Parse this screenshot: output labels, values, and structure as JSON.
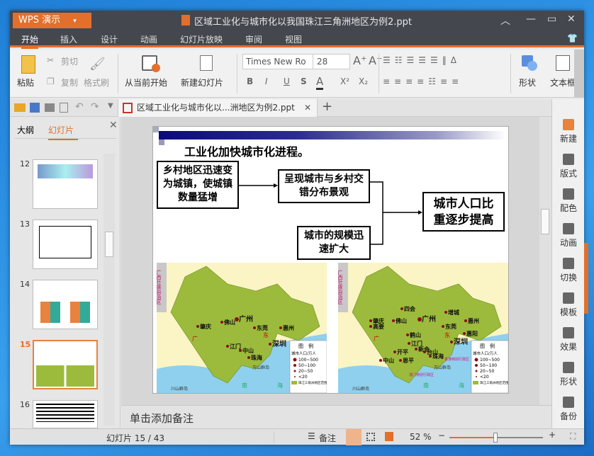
{
  "window": {
    "app_label": "WPS 演示",
    "title": "区域工业化与城市化以我国珠江三角洲地区为例2.ppt"
  },
  "menu": [
    "开始",
    "插入",
    "设计",
    "动画",
    "幻灯片放映",
    "审阅",
    "视图"
  ],
  "ribbon": {
    "paste": "粘贴",
    "cut": "剪切",
    "copy": "复制",
    "format_painter": "格式刷",
    "play_from_current": "从当前开始",
    "new_slide": "新建幻灯片",
    "font_name": "Times New Ro",
    "font_size": "28",
    "bold": "B",
    "italic": "I",
    "underline": "U",
    "shadow": "S",
    "font_color": "A",
    "superscript": "X²",
    "subscript": "X₂",
    "shape": "形状",
    "textbox": "文本框"
  },
  "doc_tab": {
    "label": "区域工业化与城市化以...洲地区为例2.ppt"
  },
  "left_panel": {
    "tabs": [
      "大纲",
      "幻灯片"
    ],
    "active_tab": "幻灯片",
    "slide_numbers": [
      "12",
      "13",
      "14",
      "15",
      "16"
    ],
    "selected": "15"
  },
  "slide": {
    "heading": "工业化加快城市化进程。",
    "boxes": {
      "rural": "乡村地区迅速变为城镇，使城镇数量猛增",
      "mixed": "呈现城市与乡村交错分布景观",
      "expand": "城市的规模迅速扩大",
      "result": "城市人口比重逐步提高"
    },
    "map_left": {
      "province_label": "广西壮族自治区",
      "cities": [
        "广州",
        "佛山",
        "肇庆",
        "东莞",
        "惠州",
        "深圳",
        "江门",
        "中山",
        "珠海"
      ],
      "region": [
        "广",
        "东"
      ],
      "sea": [
        "南",
        "海"
      ],
      "islands": "川山群岛",
      "other_islands": "万山群岛",
      "legend_title": "图　例",
      "legend_unit": "城市人口/万人",
      "legend_items": [
        "100~500",
        "50~100",
        "20~50",
        "<20",
        "珠江三角洲地区范围"
      ]
    },
    "map_right": {
      "province_label": "广西壮族自治区",
      "cities": [
        "四会",
        "增城",
        "肇庆",
        "高要",
        "佛山",
        "广州",
        "东莞",
        "惠州",
        "鹤山",
        "江门",
        "惠阳",
        "深圳",
        "开平",
        "新会",
        "中山",
        "恩平",
        "台山",
        "珠海"
      ],
      "special": [
        "香港特别行政区",
        "澳门特别行政区"
      ],
      "region": [
        "广",
        "东"
      ],
      "sea": [
        "南",
        "海"
      ],
      "islands": "川山群岛",
      "other_islands": "万山群岛",
      "legend_title": "图　例",
      "legend_unit": "城市人口/万人",
      "legend_items": [
        "100~500",
        "50~100",
        "20~50",
        "<20",
        "珠江三角洲地区范围"
      ]
    }
  },
  "notes_placeholder": "单击添加备注",
  "right_sidebar": [
    "新建",
    "版式",
    "配色",
    "动画",
    "切换",
    "模板",
    "效果",
    "形状",
    "备份"
  ],
  "status": {
    "slide_counter": "幻灯片 15 / 43",
    "notes": "备注",
    "zoom": "52 %",
    "zoom_value": 52
  },
  "colors": {
    "accent": "#e36f2c",
    "titlebar": "#45474f",
    "land": "#9cbb3c",
    "sea": "#8fd0ee"
  }
}
